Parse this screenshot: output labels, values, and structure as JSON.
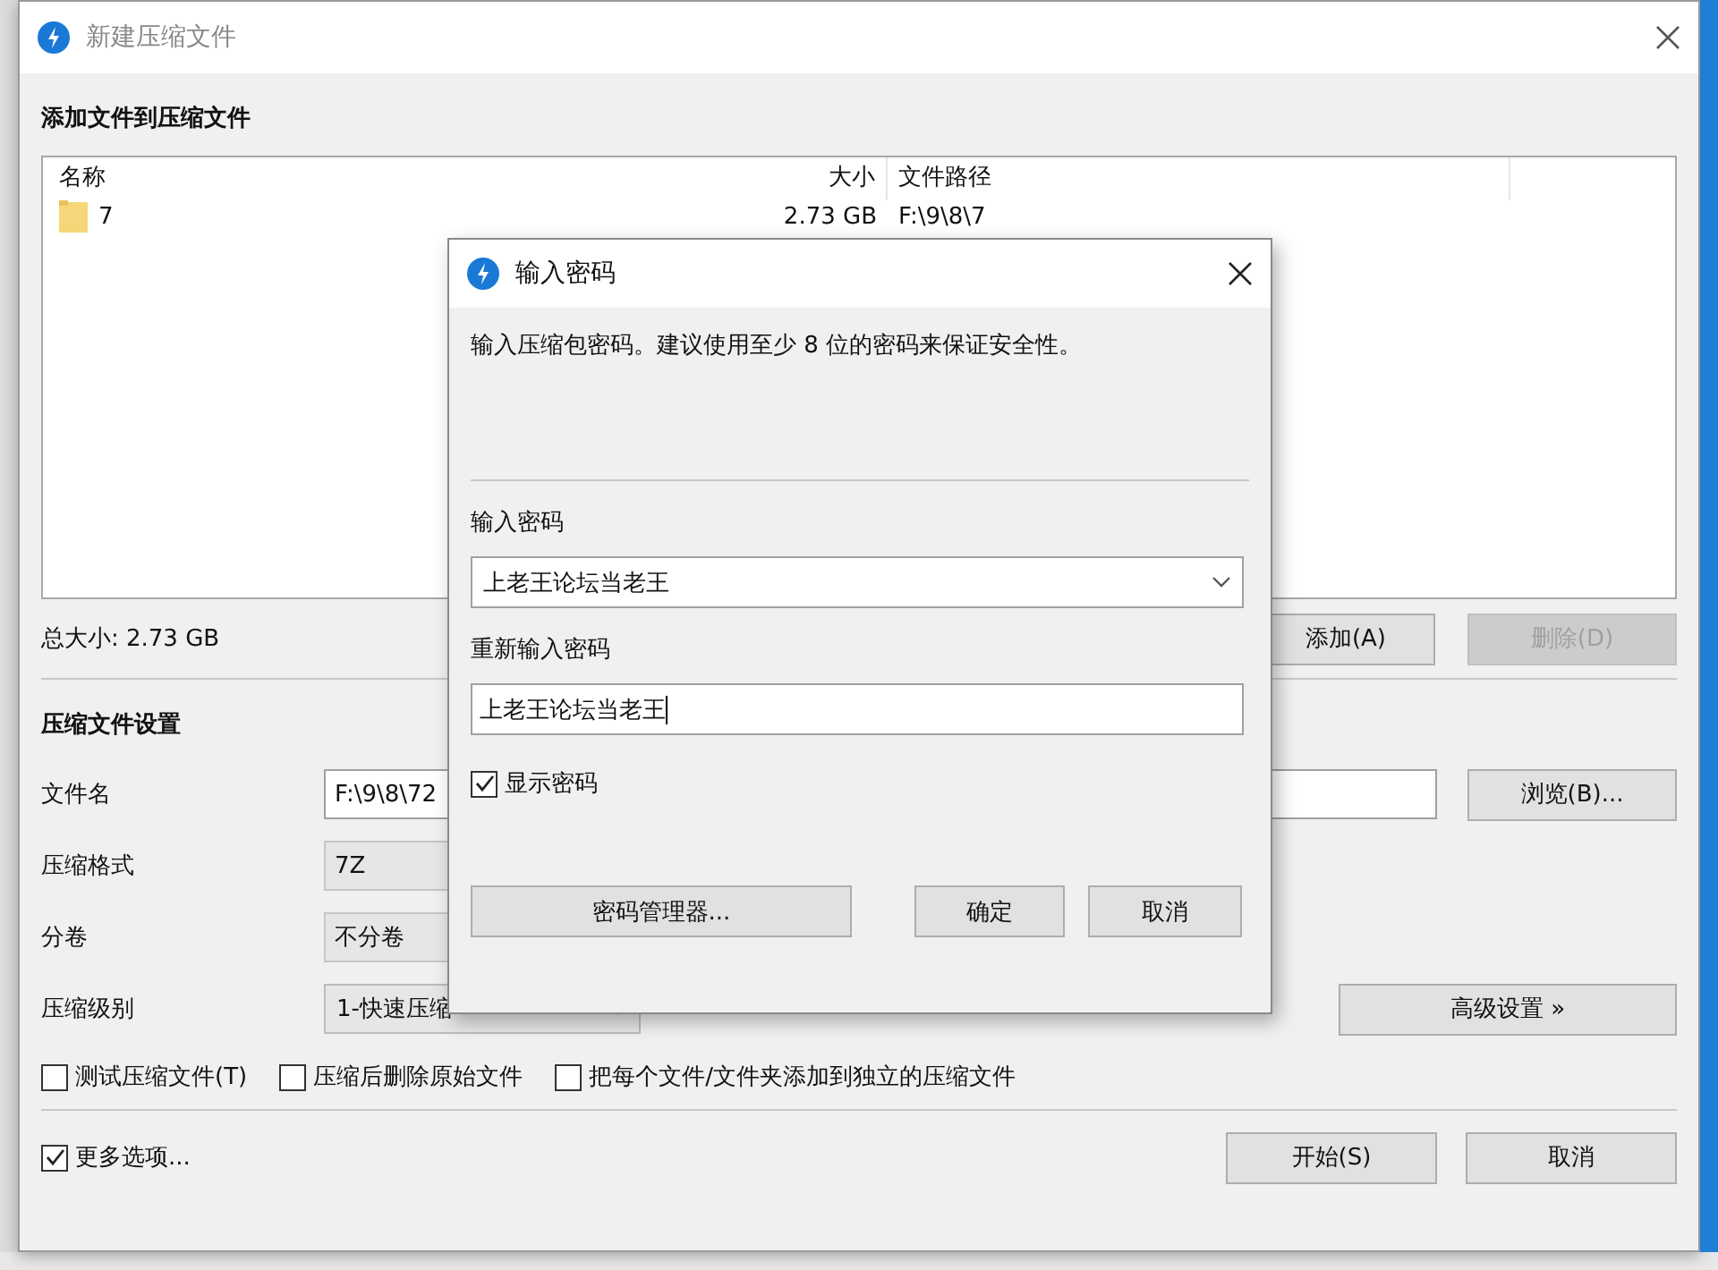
{
  "window": {
    "title": "新建压缩文件"
  },
  "files": {
    "heading": "添加文件到压缩文件",
    "columns": [
      "名称",
      "大小",
      "文件路径"
    ],
    "rows": [
      {
        "name": "7",
        "size": "2.73 GB",
        "path": "F:\\9\\8\\7"
      }
    ],
    "total": "总大小: 2.73 GB",
    "buttons": [
      {
        "label": "添加(A)",
        "disabled": false
      },
      {
        "label": "删除(D)",
        "disabled": true
      }
    ]
  },
  "settings": {
    "heading": "压缩文件设置",
    "fields": [
      {
        "label": "文件名",
        "kind": "text",
        "value": "F:\\9\\8\\72",
        "button": "浏览(B)..."
      },
      {
        "label": "压缩格式",
        "kind": "readonly",
        "value": "7Z"
      },
      {
        "label": "分卷",
        "kind": "readonly",
        "value": "不分卷"
      },
      {
        "label": "压缩级别",
        "kind": "dropdown",
        "value": "1-快速压缩",
        "button": "高级设置 »"
      }
    ],
    "options": [
      {
        "label": "测试压缩文件(T)",
        "checked": false
      },
      {
        "label": "压缩后删除原始文件",
        "checked": false
      },
      {
        "label": "把每个文件/文件夹添加到独立的压缩文件",
        "checked": false
      }
    ]
  },
  "more_options": {
    "label": "更多选项...",
    "checked": true
  },
  "footer_buttons": [
    "开始(S)",
    "取消"
  ],
  "dialog": {
    "title": "输入密码",
    "message": "输入压缩包密码。建议使用至少 8 位的密码来保证安全性。",
    "password_label": "输入密码",
    "password_value": "上老王论坛当老王",
    "confirm_label": "重新输入密码",
    "confirm_value": "上老王论坛当老王",
    "show_password": {
      "label": "显示密码",
      "checked": true
    },
    "buttons": [
      "密码管理器...",
      "确定",
      "取消"
    ]
  }
}
